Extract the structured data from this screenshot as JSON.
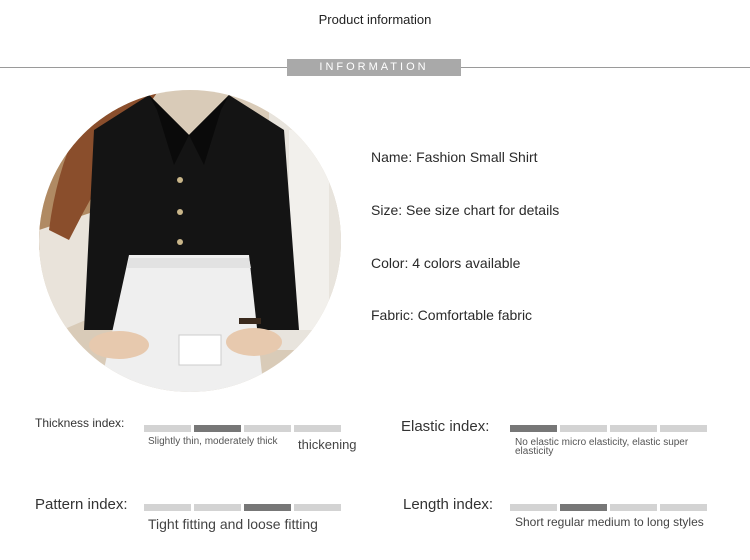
{
  "header": {
    "title": "Product information",
    "banner": "INFORMATION"
  },
  "product": {
    "name": "Name: Fashion Small Shirt",
    "size": "Size: See size chart for details",
    "color": "Color: 4 colors available",
    "fabric": "Fabric: Comfortable fabric"
  },
  "indices": {
    "thickness": {
      "label": "Thickness index:",
      "active_segment": 2,
      "desc_left": "Slightly thin, moderately thick",
      "desc_right": "thickening"
    },
    "elastic": {
      "label": "Elastic index:",
      "active_segment": 1,
      "desc": "No elastic micro elasticity, elastic super elasticity"
    },
    "pattern": {
      "label": "Pattern index:",
      "active_segment": 3,
      "desc": "Tight fitting and loose fitting"
    },
    "length": {
      "label": "Length index:",
      "active_segment": 2,
      "desc": "Short regular medium to long styles"
    }
  },
  "colors": {
    "bar_active": "#777777",
    "bar_inactive": "#d3d3d3",
    "banner_bg": "#a9a9a9"
  }
}
